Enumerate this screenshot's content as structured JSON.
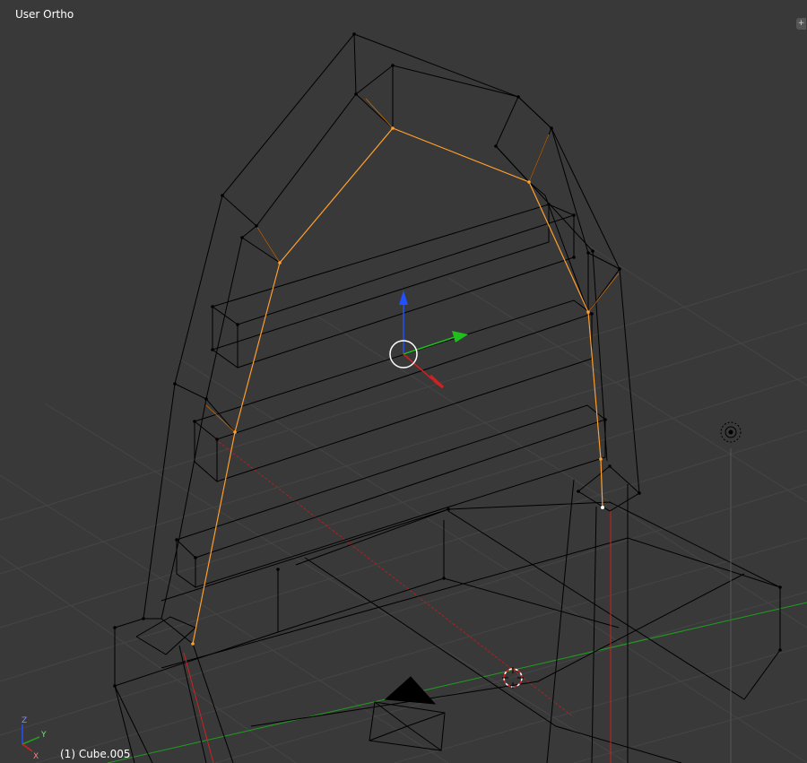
{
  "viewport": {
    "view_label": "User Ortho",
    "object_label": "(1) Cube.005",
    "corner_widget_symbol": "+"
  },
  "axis_widget": {
    "z_label": "Z",
    "y_label": "Y",
    "x_label": "X"
  },
  "colors": {
    "background": "#393939",
    "grid": "#4a4a4a",
    "wire": "#000000",
    "selected_edge": "#ffa030",
    "x_axis": "#d02020",
    "y_axis": "#1ea01e",
    "z_axis": "#2050ff"
  },
  "icons": {
    "manipulator": "translate-manipulator-icon",
    "cursor": "3d-cursor-icon",
    "lamp": "lamp-icon",
    "camera": "camera-icon",
    "axes": "axis-orientation-icon"
  }
}
